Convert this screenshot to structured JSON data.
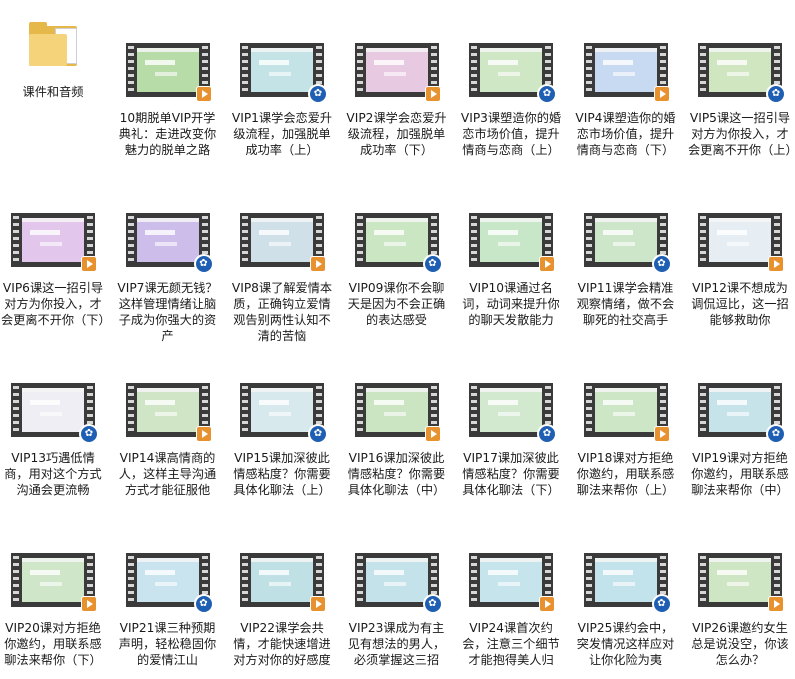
{
  "items": [
    {
      "type": "folder",
      "label": "课件和音频"
    },
    {
      "type": "video",
      "label": "10期脱单VIP开学典礼：走进改变你魅力的脱单之路",
      "color": "#b8dca8",
      "overlay": "play"
    },
    {
      "type": "video",
      "label": "VIP1课学会恋爱升级流程，加强脱单成功率（上）",
      "color": "#c3e3e6",
      "overlay": "badge"
    },
    {
      "type": "video",
      "label": "VIP2课学会恋爱升级流程，加强脱单成功率（下）",
      "color": "#e8c9e2",
      "overlay": "play"
    },
    {
      "type": "video",
      "label": "VIP3课塑造你的婚恋市场价值，提升情商与恋商（上）",
      "color": "#cfe7c5",
      "overlay": "badge"
    },
    {
      "type": "video",
      "label": "VIP4课塑造你的婚恋市场价值，提升情商与恋商（下）",
      "color": "#c8daf2",
      "overlay": "play"
    },
    {
      "type": "video",
      "label": "VIP5课这一招引导对方为你投入，才会更离不开你（上）",
      "color": "#cfe6c0",
      "overlay": "badge"
    },
    {
      "type": "video",
      "label": "VIP6课这一招引导对方为你投入，才会更离不开你（下）",
      "color": "#e2c6ec",
      "overlay": "play"
    },
    {
      "type": "video",
      "label": "VIP7课无颜无钱？这样管理情绪让脑子成为你强大的资产",
      "color": "#cdbdea",
      "overlay": "badge"
    },
    {
      "type": "video",
      "label": "VIP8课了解爱情本质，正确钩立爱情观告别两性认知不清的苦恼",
      "color": "#cfe0e8",
      "overlay": "play"
    },
    {
      "type": "video",
      "label": "VIP09课你不会聊天是因为不会正确的表达感受",
      "color": "#cbe6c3",
      "overlay": "badge"
    },
    {
      "type": "video",
      "label": "VIP10课通过名词，动词来提升你的聊天发散能力",
      "color": "#c8e7c9",
      "overlay": "play"
    },
    {
      "type": "video",
      "label": "VIP11课学会精准观察情绪，做不会聊死的社交高手",
      "color": "#cde5c8",
      "overlay": "badge"
    },
    {
      "type": "video",
      "label": "VIP12课不想成为调侃逗比，这一招能够救助你",
      "color": "#e6eef3",
      "overlay": "play"
    },
    {
      "type": "video",
      "label": "VIP13巧遇低情商，用对这个方式沟通会更流畅",
      "color": "#eeeef4",
      "overlay": "badge"
    },
    {
      "type": "video",
      "label": "VIP14课高情商的人，这样主导沟通方式才能征服他",
      "color": "#cfe5c6",
      "overlay": "play"
    },
    {
      "type": "video",
      "label": "VIP15课加深彼此情感粘度？你需要具体化聊法（上）",
      "color": "#d8e9ee",
      "overlay": "badge"
    },
    {
      "type": "video",
      "label": "VIP16课加深彼此情感粘度？你需要具体化聊法（中）",
      "color": "#cbe4c1",
      "overlay": "play"
    },
    {
      "type": "video",
      "label": "VIP17课加深彼此情感粘度？你需要具体化聊法（下）",
      "color": "#d3e9cf",
      "overlay": "badge"
    },
    {
      "type": "video",
      "label": "VIP18课对方拒绝你邀约，用联系感聊法来帮你（上）",
      "color": "#cde6c6",
      "overlay": "play"
    },
    {
      "type": "video",
      "label": "VIP19课对方拒绝你邀约，用联系感聊法来帮你（中）",
      "color": "#c6e3ea",
      "overlay": "badge"
    },
    {
      "type": "video",
      "label": "VIP20课对方拒绝你邀约，用联系感聊法来帮你（下）",
      "color": "#cfe7c8",
      "overlay": "play"
    },
    {
      "type": "video",
      "label": "VIP21课三种预期声明，轻松稳固你的爱情江山",
      "color": "#c9e4ee",
      "overlay": "badge"
    },
    {
      "type": "video",
      "label": "VIP22课学会共情，才能快速增进对方对你的好感度",
      "color": "#bfe0e4",
      "overlay": "play"
    },
    {
      "type": "video",
      "label": "VIP23课成为有主见有想法的男人，必须掌握这三招",
      "color": "#c4e2ea",
      "overlay": "badge"
    },
    {
      "type": "video",
      "label": "VIP24课首次约会，注意三个细节才能抱得美人归",
      "color": "#c6e4ec",
      "overlay": "play"
    },
    {
      "type": "video",
      "label": "VIP25课约会中，突发情况这样应对让你化险为夷",
      "color": "#c2e2ec",
      "overlay": "badge"
    },
    {
      "type": "video",
      "label": "VIP26课邀约女生总是说没空，你该怎么办？",
      "color": "#cfe6c4",
      "overlay": "play"
    }
  ]
}
